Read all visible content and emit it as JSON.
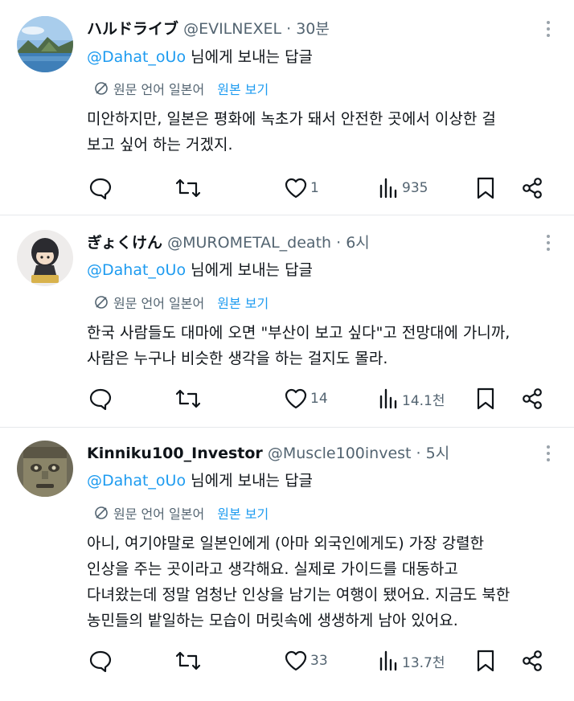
{
  "tweets": [
    {
      "name": "ハルドライブ",
      "handle": "@EVILNEXEL",
      "sep": "·",
      "time": "30분",
      "reply_mention": "@Dahat_oUo",
      "reply_suffix": " 님에게 보내는 답글",
      "translate_label": "원문 언어 일본어",
      "show_original": "원본 보기",
      "text_lines": [
        "미안하지만, 일본은 평화에 녹초가 돼서 안전한 곳에서 이상한 걸",
        "보고 싶어 하는 거겠지."
      ],
      "likes": "1",
      "views": "935",
      "avatar": "mountain-lake-photo"
    },
    {
      "name": "ぎょくけん",
      "handle": "@MUROMETAL_death",
      "sep": "·",
      "time": "6시",
      "reply_mention": "@Dahat_oUo",
      "reply_suffix": " 님에게 보내는 답글",
      "translate_label": "원문 언어 일본어",
      "show_original": "원본 보기",
      "text_lines": [
        "한국 사람들도 대마에 오면 \"부산이 보고 싶다\"고 전망대에 가니까,",
        "사람은 누구나 비슷한 생각을 하는 걸지도 몰라."
      ],
      "likes": "14",
      "views": "14.1천",
      "avatar": "figure-doll"
    },
    {
      "name": "Kinniku100_Investor",
      "handle": "@Muscle100invest",
      "sep": "·",
      "time": "5시",
      "reply_mention": "@Dahat_oUo",
      "reply_suffix": " 님에게 보내는 답글",
      "translate_label": "원문 언어 일본어",
      "show_original": "원본 보기",
      "text_lines": [
        "아니, 여기야말로 일본인에게 (아마 외국인에게도) 가장 강렬한",
        "인상을 주는 곳이라고 생각해요. 실제로 가이드를 대동하고",
        "다녀왔는데 정말 엄청난 인상을 남기는 여행이 됐어요. 지금도 북한",
        "농민들의 밭일하는 모습이 머릿속에 생생하게 남아 있어요."
      ],
      "likes": "33",
      "views": "13.7천",
      "avatar": "stone-statue"
    }
  ],
  "colors": {
    "accent": "#1d9bf0",
    "muted": "#536471",
    "text": "#0f1419",
    "divider": "#e6e9ec"
  },
  "icons": [
    "reply-icon",
    "retweet-icon",
    "like-icon",
    "views-icon",
    "bookmark-icon",
    "share-icon",
    "translate-icon",
    "more-icon"
  ]
}
